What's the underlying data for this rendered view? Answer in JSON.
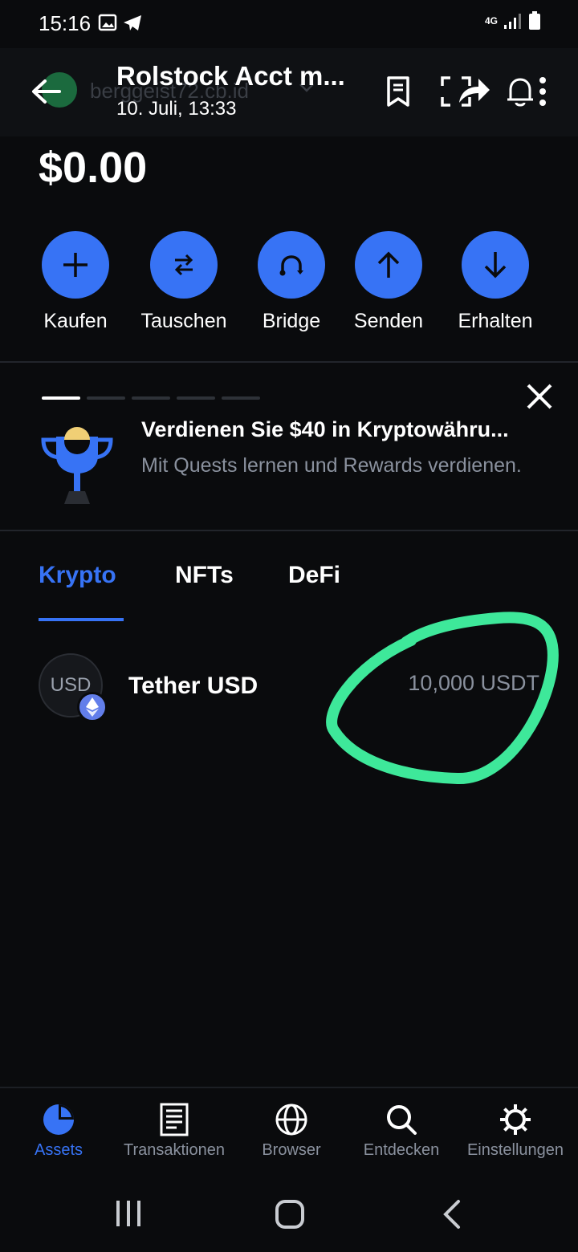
{
  "status_bar": {
    "time": "15:16",
    "network": "4G"
  },
  "header": {
    "title": "Rolstock Acct m...",
    "subtitle": "10. Juli, 13:33",
    "ghost_account": "berggeist72.cb.id"
  },
  "wallet": {
    "balance": "$0.00"
  },
  "actions": [
    {
      "label": "Kaufen",
      "icon": "plus-icon"
    },
    {
      "label": "Tauschen",
      "icon": "swap-icon"
    },
    {
      "label": "Bridge",
      "icon": "bridge-icon"
    },
    {
      "label": "Senden",
      "icon": "arrow-up-icon"
    },
    {
      "label": "Erhalten",
      "icon": "arrow-down-icon"
    }
  ],
  "promo": {
    "title": "Verdienen Sie $40 in Kryptowähru...",
    "description": "Mit Quests lernen und Rewards verdienen."
  },
  "tabs": [
    {
      "label": "Krypto",
      "active": true
    },
    {
      "label": "NFTs",
      "active": false
    },
    {
      "label": "DeFi",
      "active": false
    }
  ],
  "assets": [
    {
      "icon_text": "USD",
      "name": "Tether USD",
      "amount": "10,000 USDT",
      "network_badge": "ethereum-icon"
    }
  ],
  "bottom_nav": [
    {
      "label": "Assets",
      "icon": "pie-chart-icon",
      "active": true
    },
    {
      "label": "Transaktionen",
      "icon": "receipt-icon",
      "active": false
    },
    {
      "label": "Browser",
      "icon": "globe-icon",
      "active": false
    },
    {
      "label": "Entdecken",
      "icon": "search-icon",
      "active": false
    },
    {
      "label": "Einstellungen",
      "icon": "gear-icon",
      "active": false
    }
  ],
  "colors": {
    "accent": "#3773f5",
    "background": "#0a0b0d",
    "annotation": "#3ee89a"
  }
}
